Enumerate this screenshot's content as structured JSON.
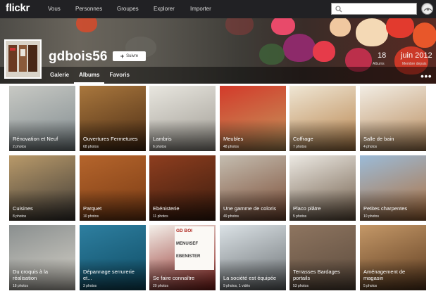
{
  "app": {
    "logo": "flickr"
  },
  "topnav": {
    "items": [
      "Vous",
      "Personnes",
      "Groupes",
      "Explorer",
      "Importer"
    ]
  },
  "profile": {
    "username": "gdbois56",
    "follow_label": "Suivre",
    "albums_count": "18",
    "albums_label": "Albums",
    "member_since": "juin 2012",
    "member_since_label": "Membre depuis"
  },
  "tabs": [
    "Galerie",
    "Albums",
    "Favoris"
  ],
  "active_tab": "Albums",
  "more_label": "•••",
  "albums": [
    {
      "title": "Rénovation et Neuf",
      "count": "2 photos",
      "colors": [
        "#c8c9c4",
        "#7f8a8e"
      ]
    },
    {
      "title": "Ouvertures Fermetures",
      "count": "68 photos",
      "colors": [
        "#a9773d",
        "#4b2c14"
      ]
    },
    {
      "title": "Lambris",
      "count": "6 photos",
      "colors": [
        "#e8e6df",
        "#9e9a92"
      ]
    },
    {
      "title": "Meubles",
      "count": "48 photos",
      "colors": [
        "#d33a2a",
        "#c49a5e"
      ]
    },
    {
      "title": "Coffrage",
      "count": "7 photos",
      "colors": [
        "#efe6d4",
        "#b7824a"
      ]
    },
    {
      "title": "Salle de bain",
      "count": "4 photos",
      "colors": [
        "#f2ede4",
        "#b88a5a"
      ]
    },
    {
      "title": "Cuisines",
      "count": "8 photos",
      "colors": [
        "#b99a6a",
        "#3e3a36"
      ]
    },
    {
      "title": "Parquet",
      "count": "10 photos",
      "colors": [
        "#b5652c",
        "#7a3b14"
      ]
    },
    {
      "title": "Ebénisterie",
      "count": "11 photos",
      "colors": [
        "#8e3e1f",
        "#3b1c0e"
      ]
    },
    {
      "title": "Une gamme de coloris",
      "count": "49 photos",
      "colors": [
        "#c4bdb0",
        "#7a4a33"
      ]
    },
    {
      "title": "Placo plâtre",
      "count": "5 photos",
      "colors": [
        "#ece9e3",
        "#6e5a46"
      ]
    },
    {
      "title": "Petites charpentes",
      "count": "10 photos",
      "colors": [
        "#9bbbd8",
        "#b0703c"
      ]
    },
    {
      "title": "Du croquis à la réalisation",
      "count": "18 photos",
      "colors": [
        "#8a8f8f",
        "#d6d2c8"
      ]
    },
    {
      "title": "Dépannage serrurerie et...",
      "count": "3 photos",
      "colors": [
        "#2e7fa0",
        "#0e4b63"
      ]
    },
    {
      "title": "Se faire connaître",
      "count": "20 photos",
      "colors": [
        "#f4f0ea",
        "#8a1f1a"
      ]
    },
    {
      "title": "La société est équipée",
      "count": "9 photos, 1 vidéo",
      "colors": [
        "#dbe2e6",
        "#6a6f72"
      ]
    },
    {
      "title": "Terrasses Bardages portails",
      "count": "53 photos",
      "colors": [
        "#8e7560",
        "#5b4a3c"
      ]
    },
    {
      "title": "Aménagement de magasin",
      "count": "5 photos",
      "colors": [
        "#c49868",
        "#5c3a1e"
      ]
    }
  ],
  "sign_text": {
    "line1": "GD BOI",
    "line2": "MENUISEF",
    "line3": "EBENISTER"
  }
}
